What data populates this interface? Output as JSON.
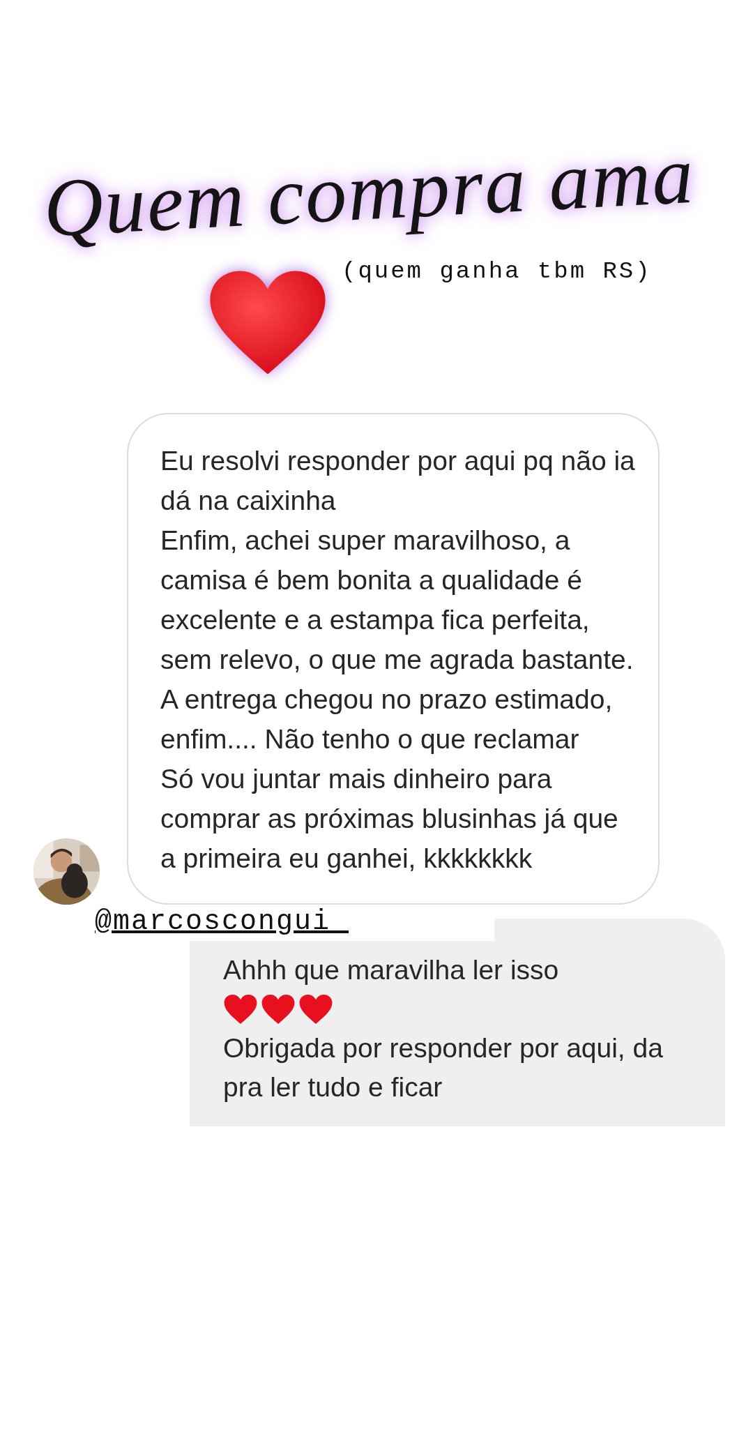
{
  "title": "Quem compra ama",
  "subtitle": "(quem ganha tbm RS)",
  "question_reply": {
    "text": "Eu resolvi responder por aqui pq não ia dá na caixinha\nEnfim, achei super maravilhoso, a camisa é bem bonita a qualidade é excelente e a estampa fica perfeita, sem relevo, o que me agrada bastante. A entrega chegou no prazo estimado, enfim.... Não tenho o que reclamar\nSó vou juntar mais dinheiro para comprar as próximas blusinhas já que a primeira eu ganhei, kkkkkkkk"
  },
  "reply": {
    "username": "@marcoscongui_",
    "text_before": "Ahhh que maravilha ler isso",
    "text_after": "Obrigada por responder por aqui, da pra ler tudo e ficar"
  }
}
